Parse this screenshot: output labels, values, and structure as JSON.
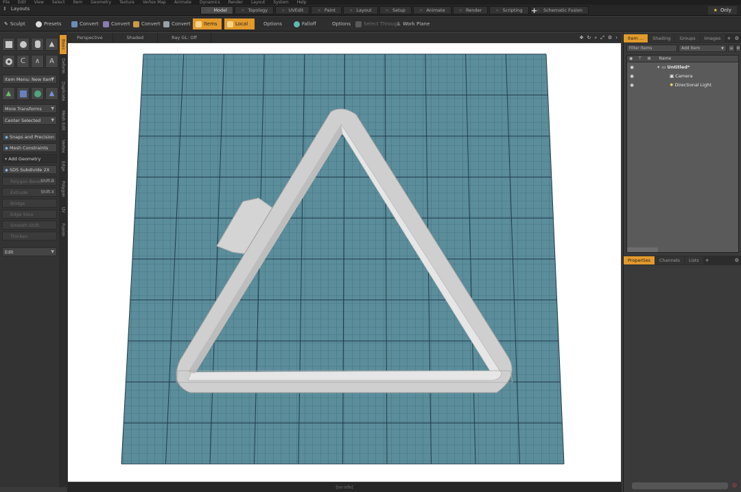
{
  "menubar": {
    "items": [
      "File",
      "Edit",
      "View",
      "Select",
      "Item",
      "Geometry",
      "Texture",
      "Vertex Map",
      "Animate",
      "Dynamics",
      "Render",
      "Layout",
      "System",
      "Help"
    ]
  },
  "layoutbar": {
    "layouts_label": "Layouts",
    "tabs": [
      {
        "label": "Model",
        "active": true
      },
      {
        "label": "Topology",
        "active": false
      },
      {
        "label": "UVEdit",
        "active": false
      },
      {
        "label": "Paint",
        "active": false
      },
      {
        "label": "Layout",
        "active": false
      },
      {
        "label": "Setup",
        "active": false
      },
      {
        "label": "Animate",
        "active": false
      },
      {
        "label": "Render",
        "active": false
      },
      {
        "label": "Scripting",
        "active": false
      },
      {
        "label": "Schematic Fusion",
        "active": false
      }
    ],
    "add_tab_label": "+",
    "only_label": "Only"
  },
  "toolbar": {
    "sculpt_label": "Sculpt",
    "presets_label": "Presets",
    "convert_labels": [
      "Convert",
      "Convert",
      "Convert",
      "Convert"
    ],
    "items_label": "Items",
    "local_label": "Local",
    "options_label": "Options",
    "falloff_label": "Falloff",
    "options2_label": "Options",
    "select_through_label": "Select Through",
    "work_plane_label": "Work Plane"
  },
  "leftpanel": {
    "item_menu": "Item Menu: New Item",
    "more_transforms": "More Transforms",
    "center_selected": "Center Selected",
    "snaps": "Snaps and Precision",
    "mesh_constraints": "Mesh Constraints",
    "add_geometry": "Add Geometry",
    "sds_subdivide": "SDS Subdivide 2X",
    "disabled_tools": [
      {
        "label": "Polygon Bevel",
        "shortcut": "Shift-B"
      },
      {
        "label": "Extrude",
        "shortcut": "Shift-X"
      },
      {
        "label": "Bridge",
        "shortcut": ""
      },
      {
        "label": "Edge Slice",
        "shortcut": ""
      },
      {
        "label": "Smooth Shift",
        "shortcut": ""
      },
      {
        "label": "Thicken",
        "shortcut": ""
      }
    ],
    "edit": "Edit"
  },
  "vtabs": [
    "Basic",
    "Deform",
    "Duplicate",
    "Mesh Edit",
    "Vertex",
    "Edge",
    "Polygon",
    "UV",
    "Fusion"
  ],
  "viewport": {
    "view_label": "Perspective",
    "shading_label": "Shaded",
    "raygl_label": "Ray GL: Off",
    "grid_color": "#5b8d9b",
    "line_color": "#3a5f6d"
  },
  "statusbar": {
    "text": "[no info]"
  },
  "rightpanel": {
    "tabs": [
      {
        "label": "Item ...",
        "active": true
      },
      {
        "label": "Shading",
        "active": false
      },
      {
        "label": "Groups",
        "active": false
      },
      {
        "label": "Images",
        "active": false
      }
    ],
    "filter_label": "Filter Items",
    "add_item_label": "Add Item",
    "name_header": "Name",
    "tree": [
      {
        "label": "Untitled*",
        "level": 0,
        "icon": "scene-icon"
      },
      {
        "label": "Camera",
        "level": 1,
        "icon": "camera-icon"
      },
      {
        "label": "Directional Light",
        "level": 1,
        "icon": "light-icon"
      }
    ],
    "bottom_tabs": [
      {
        "label": "Properties",
        "active": true
      },
      {
        "label": "Channels",
        "active": false
      },
      {
        "label": "Lists",
        "active": false
      }
    ]
  },
  "colors": {
    "accent": "#e29a2b",
    "panel": "#3a3a3a",
    "viewport_bg": "#ffffff"
  }
}
